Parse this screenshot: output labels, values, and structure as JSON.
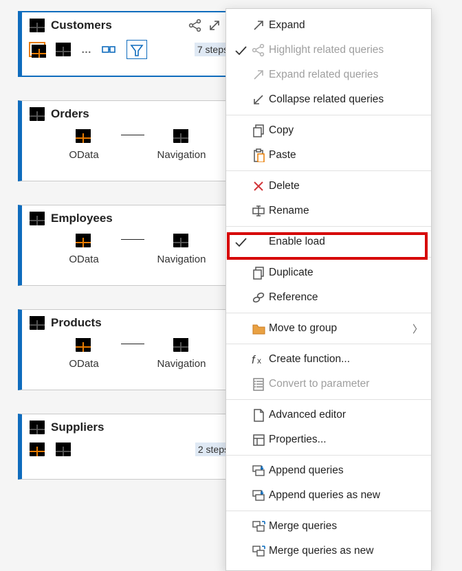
{
  "cards": {
    "customers": {
      "name": "Customers",
      "steps_label": "7 steps"
    },
    "orders": {
      "name": "Orders",
      "pipe1": "OData",
      "pipe2": "Navigation"
    },
    "employees": {
      "name": "Employees",
      "pipe1": "OData",
      "pipe2": "Navigation"
    },
    "products": {
      "name": "Products",
      "pipe1": "OData",
      "pipe2": "Navigation"
    },
    "suppliers": {
      "name": "Suppliers",
      "steps_label": "2 steps"
    }
  },
  "menu": {
    "expand": "Expand",
    "highlight_related": "Highlight related queries",
    "expand_related": "Expand related queries",
    "collapse_related": "Collapse related queries",
    "copy": "Copy",
    "paste": "Paste",
    "delete": "Delete",
    "rename": "Rename",
    "enable_load": "Enable load",
    "duplicate": "Duplicate",
    "reference": "Reference",
    "move_to_group": "Move to group",
    "create_function": "Create function...",
    "convert_to_parameter": "Convert to parameter",
    "advanced_editor": "Advanced editor",
    "properties": "Properties...",
    "append_queries": "Append queries",
    "append_queries_as_new": "Append queries as new",
    "merge_queries": "Merge queries",
    "merge_queries_as_new": "Merge queries as new"
  }
}
